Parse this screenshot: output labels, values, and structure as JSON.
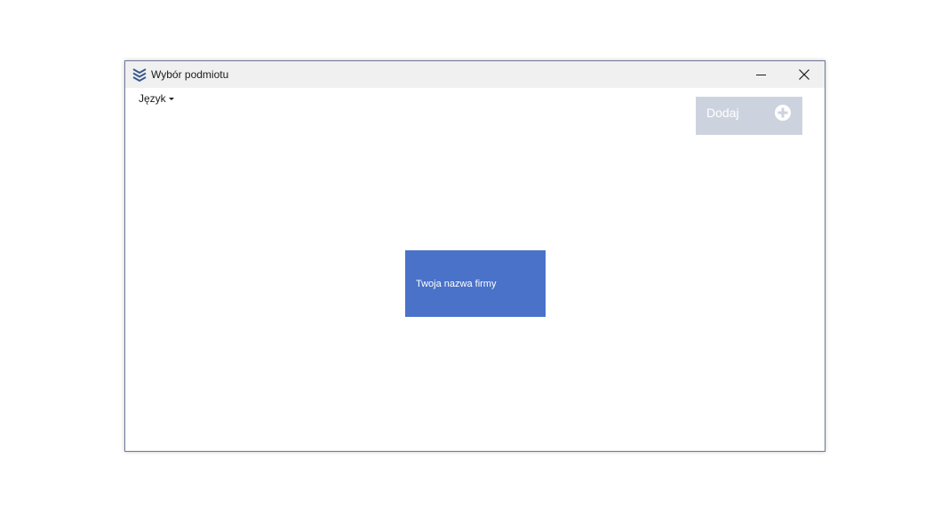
{
  "window": {
    "title": "Wybór podmiotu",
    "app_icon": "layers-chevron-icon",
    "controls": {
      "minimize_icon": "minimize-icon",
      "close_icon": "close-icon"
    }
  },
  "menu": {
    "language_label": "Język"
  },
  "toolbar": {
    "add_label": "Dodaj",
    "add_icon": "plus-circle-icon",
    "add_bg": "#cdd3de"
  },
  "companies": [
    {
      "name": "Twoja nazwa firmy",
      "color": "#4a72c9"
    }
  ]
}
